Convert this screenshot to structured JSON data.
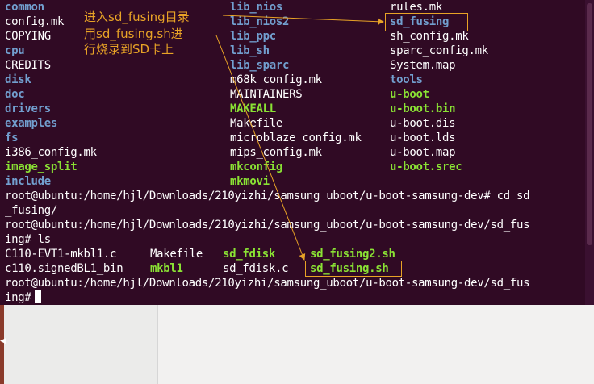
{
  "terminal": {
    "listing_rows": [
      [
        "common",
        "lib_nios",
        "rules.mk"
      ],
      [
        "config.mk",
        "lib_nios2",
        "sd_fusing"
      ],
      [
        "COPYING",
        "lib_ppc",
        "sh_config.mk"
      ],
      [
        "cpu",
        "lib_sh",
        "sparc_config.mk"
      ],
      [
        "CREDITS",
        "lib_sparc",
        "System.map"
      ],
      [
        "disk",
        "m68k_config.mk",
        "tools"
      ],
      [
        "doc",
        "MAINTAINERS",
        "u-boot"
      ],
      [
        "drivers",
        "MAKEALL",
        "u-boot.bin"
      ],
      [
        "examples",
        "Makefile",
        "u-boot.dis"
      ],
      [
        "fs",
        "microblaze_config.mk",
        "u-boot.lds"
      ],
      [
        "i386_config.mk",
        "mips_config.mk",
        "u-boot.map"
      ],
      [
        "image_split",
        "mkconfig",
        "u-boot.srec"
      ],
      [
        "include",
        "mkmovi",
        ""
      ]
    ],
    "prompt_cd_line1": "root@ubuntu:/home/hjl/Downloads/210yizhi/samsung_uboot/u-boot-samsung-dev# cd sd",
    "prompt_cd_line2": "_fusing/",
    "prompt_ls_line1": "root@ubuntu:/home/hjl/Downloads/210yizhi/samsung_uboot/u-boot-samsung-dev/sd_fus",
    "prompt_ls_line2": "ing# ls",
    "ls_row1": [
      "C110-EVT1-mkbl1.c",
      "Makefile",
      "sd_fdisk",
      "sd_fusing2.sh"
    ],
    "ls_row2": [
      "c110.signedBL1_bin",
      "mkbl1",
      "sd_fdisk.c",
      "sd_fusing.sh"
    ],
    "prompt_final_line1": "root@ubuntu:/home/hjl/Downloads/210yizhi/samsung_uboot/u-boot-samsung-dev/sd_fus",
    "prompt_final_line2": "ing#"
  },
  "annotations": {
    "line1": "进入sd_fusing目录",
    "line2": "用sd_fusing.sh进",
    "line3": "行烧录到SD卡上"
  },
  "colors": {
    "terminal_bg": "#300a24",
    "text": "#ffffff",
    "directory": "#729fcf",
    "executable": "#8ae234",
    "annotation": "#e8a326"
  }
}
